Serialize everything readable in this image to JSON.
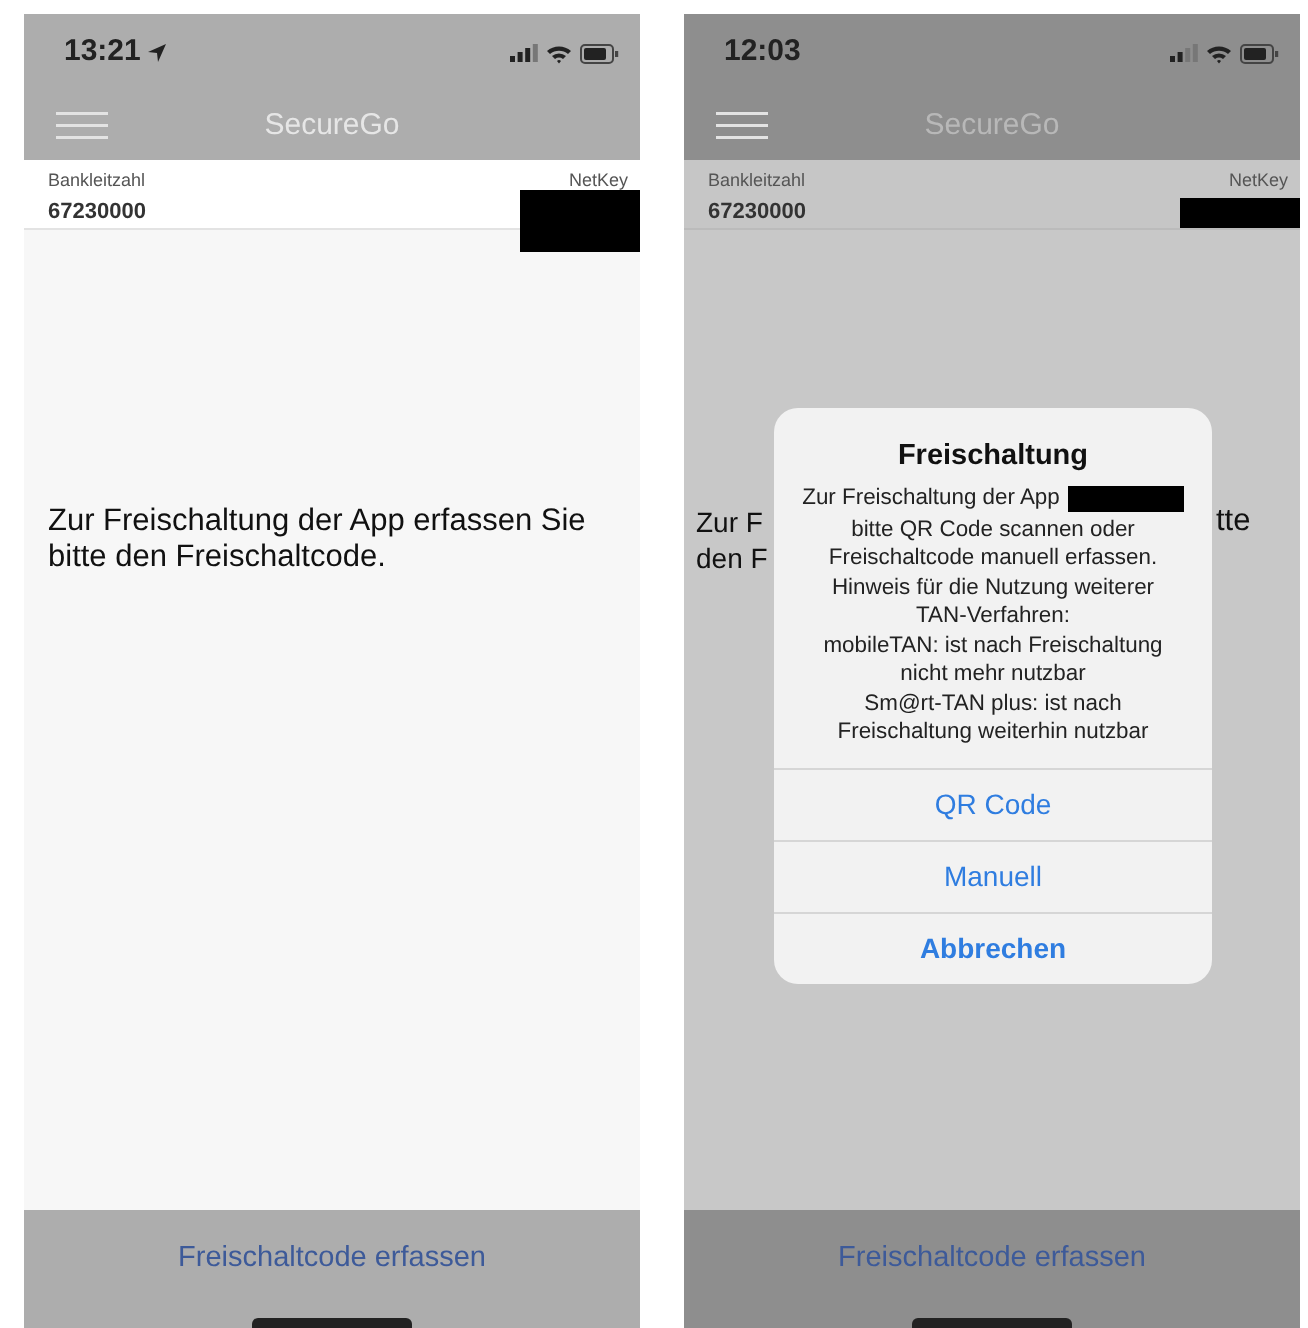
{
  "screens": [
    {
      "dimmed": false,
      "status_bar": {
        "time": "13:21",
        "location_services": true
      },
      "app_title": "SecureGo",
      "account": {
        "label": "Bankleitzahl",
        "value": "67230000",
        "key_label": "NetKey"
      },
      "message": "Zur Freischaltung der App erfassen Sie bitte den Freischaltcode.",
      "bottom_button": "Freischaltcode erfassen"
    },
    {
      "dimmed": true,
      "status_bar": {
        "time": "12:03",
        "location_services": false
      },
      "app_title": "SecureGo",
      "account": {
        "label": "Bankleitzahl",
        "value": "67230000",
        "key_label": "NetKey"
      },
      "message_left_fragments": [
        "Zur F",
        "den F"
      ],
      "message_right_fragment": "tte",
      "bottom_button": "Freischaltcode erfassen",
      "alert": {
        "title": "Freischaltung",
        "message_first_line": "Zur Freischaltung der App",
        "message": "bitte QR Code scannen oder\nFreischaltcode manuell erfassen.\nHinweis für die Nutzung weiterer\nTAN-Verfahren:\nmobileTAN: ist nach Freischaltung\nnicht mehr nutzbar\nSm@rt-TAN plus: ist nach\nFreischaltung weiterhin nutzbar",
        "actions": [
          {
            "label": "QR Code",
            "kind": "default"
          },
          {
            "label": "Manuell",
            "kind": "default"
          },
          {
            "label": "Abbrechen",
            "kind": "cancel"
          }
        ]
      }
    }
  ]
}
